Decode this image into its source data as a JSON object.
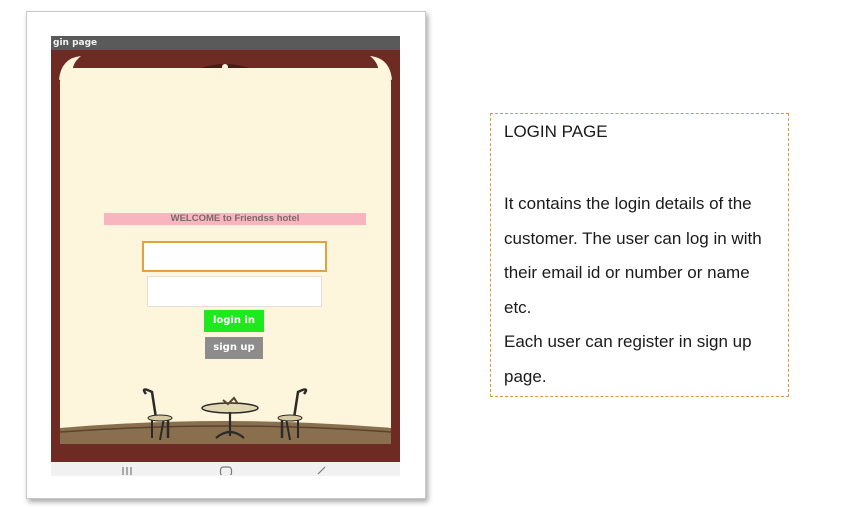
{
  "app": {
    "title_bar": "gin page",
    "welcome": "WELCOME to Friendss hotel",
    "username": {
      "value": "",
      "placeholder": ""
    },
    "password": {
      "value": "",
      "placeholder": ""
    },
    "login_label": "login in",
    "signup_label": "sign up"
  },
  "description": {
    "title": "LOGIN PAGE",
    "body": " It contains the login details of the customer. The user can log in with their email id or number or name etc.\nEach user can register in sign up page."
  },
  "icons": [
    "back-icon",
    "home-icon",
    "recent-apps-icon",
    "cafe-table-chairs-illustration"
  ],
  "colors": {
    "frame": "#6e2b23",
    "paper": "#fdf6dc",
    "welcome_bg": "#f8b4bf",
    "login_bg": "#1ee81e",
    "signup_bg": "#8c8c8c",
    "input_focus_border": "#e0a43a",
    "desc_border": "#e8923a"
  }
}
